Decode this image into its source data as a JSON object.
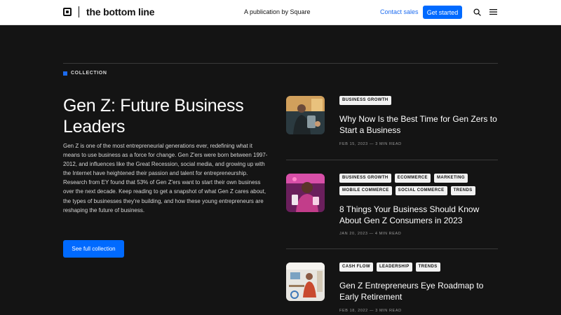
{
  "header": {
    "brand_name": "the bottom line",
    "tagline": "A publication by Square",
    "contact_label": "Contact sales",
    "cta_label": "Get started",
    "icons": {
      "search": "search-icon",
      "menu": "menu-icon",
      "logo": "square-logo-icon"
    }
  },
  "collection": {
    "label": "COLLECTION",
    "title": "Gen Z: Future Business Leaders",
    "description": "Gen Z is one of the most entrepreneurial generations ever, redefining what it means to use business as a force for change. Gen Z'ers were born between 1997-2012, and influences like the Great Recession, social media, and growing up with the Internet have heightened their passion and talent for entrepreneurship. Research from EY found that 53% of Gen Z'ers want to start their own business over the next decade. Keep reading to get a snapshot of what Gen Z cares about, the types of businesses they're building, and how these young entrepreneurs are reshaping the future of business.",
    "button_label": "See full collection"
  },
  "articles": [
    {
      "tags": [
        "BUSINESS GROWTH"
      ],
      "title": "Why Now Is the Best Time for Gen Zers to Start a Business",
      "meta": "FEB 15, 2023 — 3 MIN READ"
    },
    {
      "tags": [
        "BUSINESS GROWTH",
        "ECOMMERCE",
        "MARKETING",
        "MOBILE COMMERCE",
        "SOCIAL COMMERCE",
        "TRENDS"
      ],
      "title": "8 Things Your Business Should Know About Gen Z Consumers in 2023",
      "meta": "JAN 20, 2023 — 4 MIN READ"
    },
    {
      "tags": [
        "CASH FLOW",
        "LEADERSHIP",
        "TRENDS"
      ],
      "title": "Gen Z Entrepreneurs Eye Roadmap to Early Retirement",
      "meta": "FEB 18, 2022 — 3 MIN READ"
    }
  ],
  "colors": {
    "background": "#141414",
    "accent": "#006aff",
    "link": "#1d6cf0"
  }
}
